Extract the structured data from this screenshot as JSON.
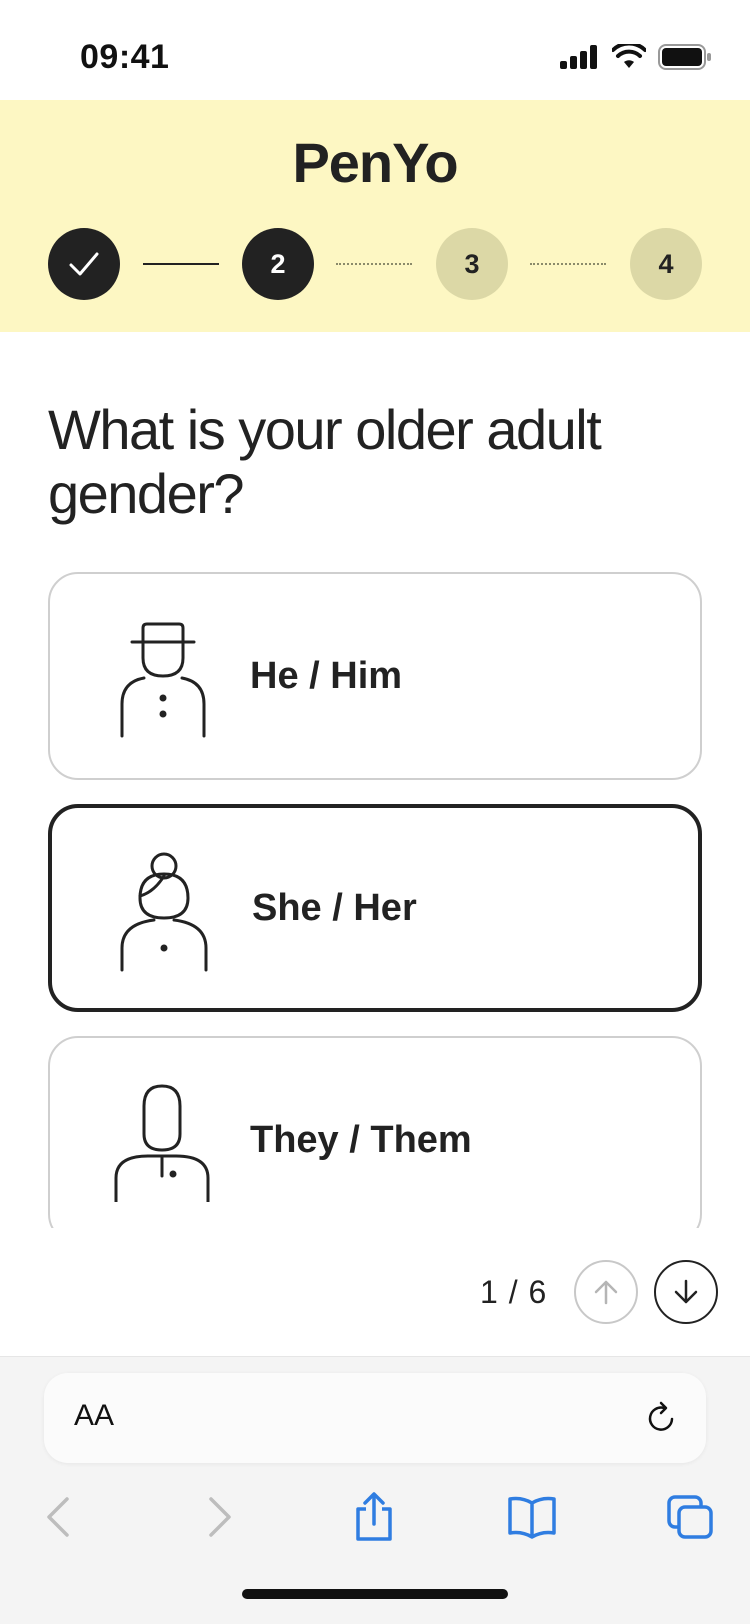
{
  "status_bar": {
    "time": "09:41"
  },
  "header": {
    "logo": "PenYo",
    "steps": [
      {
        "label": "",
        "state": "done"
      },
      {
        "label": "2",
        "state": "active"
      },
      {
        "label": "3",
        "state": "todo"
      },
      {
        "label": "4",
        "state": "todo"
      }
    ]
  },
  "question": "What is your older adult gender?",
  "options": [
    {
      "label": "He / Him",
      "icon": "man-with-hat-icon",
      "selected": false
    },
    {
      "label": "She / Her",
      "icon": "woman-with-bun-icon",
      "selected": true
    },
    {
      "label": "They / Them",
      "icon": "person-neutral-icon",
      "selected": false
    }
  ],
  "pager": {
    "count": "1 / 6"
  },
  "browser": {
    "text_size_label": "AA"
  },
  "colors": {
    "header_bg": "#fdf7c3",
    "accent_dark": "#222222",
    "todo_step": "#dcd8a6",
    "link_blue": "#2f7de1"
  }
}
